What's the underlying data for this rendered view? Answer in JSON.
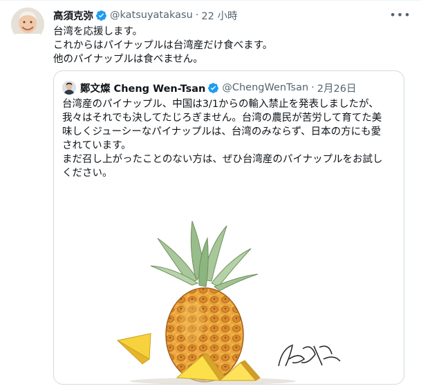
{
  "tweet": {
    "display_name": "高須克弥",
    "handle": "@katsuyatakasu",
    "separator": "·",
    "time": "22 小時",
    "more_label": "•••",
    "lines": [
      "台湾を応援します。",
      "これからはパイナップルは台湾産だけ食べます。",
      "他のパイナップルは食べません。"
    ]
  },
  "quote": {
    "display_name": "鄭文燦 Cheng Wen-Tsan",
    "handle": "@ChengWenTsan",
    "separator": "·",
    "time": "2月26日",
    "lines": [
      "台湾産のパイナップル、中国は3/1からの輸入禁止を発表しましたが、",
      "我々はそれでも決してたじろぎません。台湾の農民が苦労して育てた美",
      "味しくジューシーなパイナップルは、台湾のみならず、日本の方にも愛",
      "されています。",
      "まだ召し上がったことのない方は、ぜひ台湾産のパイナップルをお試し",
      "ください。"
    ],
    "image_signature": "BIG CUN"
  },
  "colors": {
    "verified": "#1d9bf0",
    "text": "#0f1419",
    "secondary": "#536471",
    "border": "#cfd9de"
  },
  "icons": {
    "verified": "verified-badge-icon",
    "more": "more-options-icon"
  }
}
